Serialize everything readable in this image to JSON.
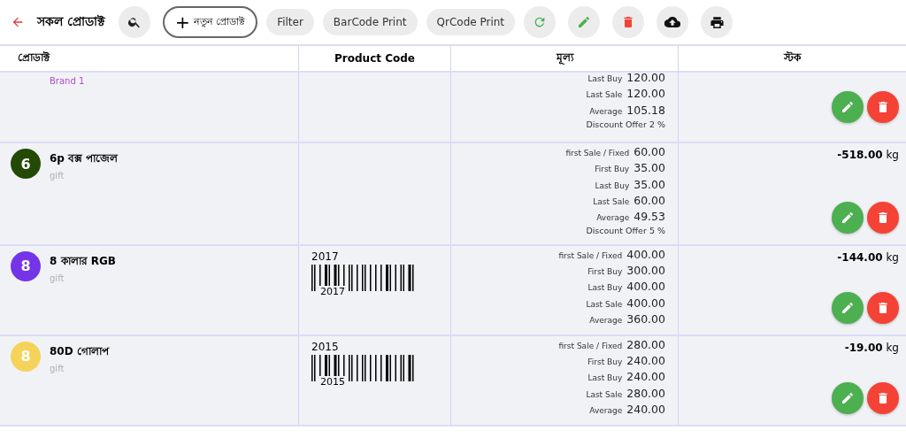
{
  "toolbar": {
    "title": "সকল প্রোডাক্ট",
    "new_button": {
      "symbol": "+",
      "label": "নতুন প্রোডাক্ট"
    },
    "chips": [
      "Filter",
      "BarCode Print",
      "QrCode Print"
    ]
  },
  "table": {
    "columns": [
      "প্রোডাক্ট",
      "Product Code",
      "মূল্য",
      "স্টক"
    ],
    "rows": [
      {
        "avatar": null,
        "name": null,
        "tag": {
          "text": "Brand 1",
          "color": "#b04cc8"
        },
        "code": null,
        "prices": [
          {
            "kind": "price",
            "label": "Last Buy",
            "value": "120.00"
          },
          {
            "kind": "price",
            "label": "Last Sale",
            "value": "120.00"
          },
          {
            "kind": "price",
            "label": "Average",
            "value": "105.18"
          },
          {
            "kind": "note",
            "label": "Discount Offer 2 %"
          }
        ],
        "stock": null
      },
      {
        "avatar": {
          "letter": "6",
          "color": "#234a05"
        },
        "name": "6p বক্স পাজেল",
        "tag": {
          "text": "gift",
          "color": "#b0b0b0"
        },
        "code": null,
        "prices": [
          {
            "kind": "price",
            "label": "first Sale / Fixed",
            "value": "60.00"
          },
          {
            "kind": "price",
            "label": "First Buy",
            "value": "35.00"
          },
          {
            "kind": "price",
            "label": "Last Buy",
            "value": "35.00"
          },
          {
            "kind": "price",
            "label": "Last Sale",
            "value": "60.00"
          },
          {
            "kind": "price",
            "label": "Average",
            "value": "49.53"
          },
          {
            "kind": "note",
            "label": "Discount Offer 5 %"
          }
        ],
        "stock": {
          "amount": "-518.00",
          "unit": "kg"
        }
      },
      {
        "avatar": {
          "letter": "8",
          "color": "#7434e8"
        },
        "name": "8 কালার RGB",
        "tag": {
          "text": "gift",
          "color": "#b0b0b0"
        },
        "code": {
          "text": "2017",
          "barcode_text": "2017"
        },
        "prices": [
          {
            "kind": "price",
            "label": "first Sale / Fixed",
            "value": "400.00"
          },
          {
            "kind": "price",
            "label": "First Buy",
            "value": "300.00"
          },
          {
            "kind": "price",
            "label": "Last Buy",
            "value": "400.00"
          },
          {
            "kind": "price",
            "label": "Last Sale",
            "value": "400.00"
          },
          {
            "kind": "price",
            "label": "Average",
            "value": "360.00"
          }
        ],
        "stock": {
          "amount": "-144.00",
          "unit": "kg"
        }
      },
      {
        "avatar": {
          "letter": "8",
          "color": "#f5d35a"
        },
        "name": "80D গোলাপ",
        "tag": {
          "text": "gift",
          "color": "#b0b0b0"
        },
        "code": {
          "text": "2015",
          "barcode_text": "2015"
        },
        "prices": [
          {
            "kind": "price",
            "label": "first Sale / Fixed",
            "value": "280.00"
          },
          {
            "kind": "price",
            "label": "First Buy",
            "value": "240.00"
          },
          {
            "kind": "price",
            "label": "Last Buy",
            "value": "240.00"
          },
          {
            "kind": "price",
            "label": "Last Sale",
            "value": "280.00"
          },
          {
            "kind": "price",
            "label": "Average",
            "value": "240.00"
          }
        ],
        "stock": {
          "amount": "-19.00",
          "unit": "kg"
        }
      }
    ]
  }
}
